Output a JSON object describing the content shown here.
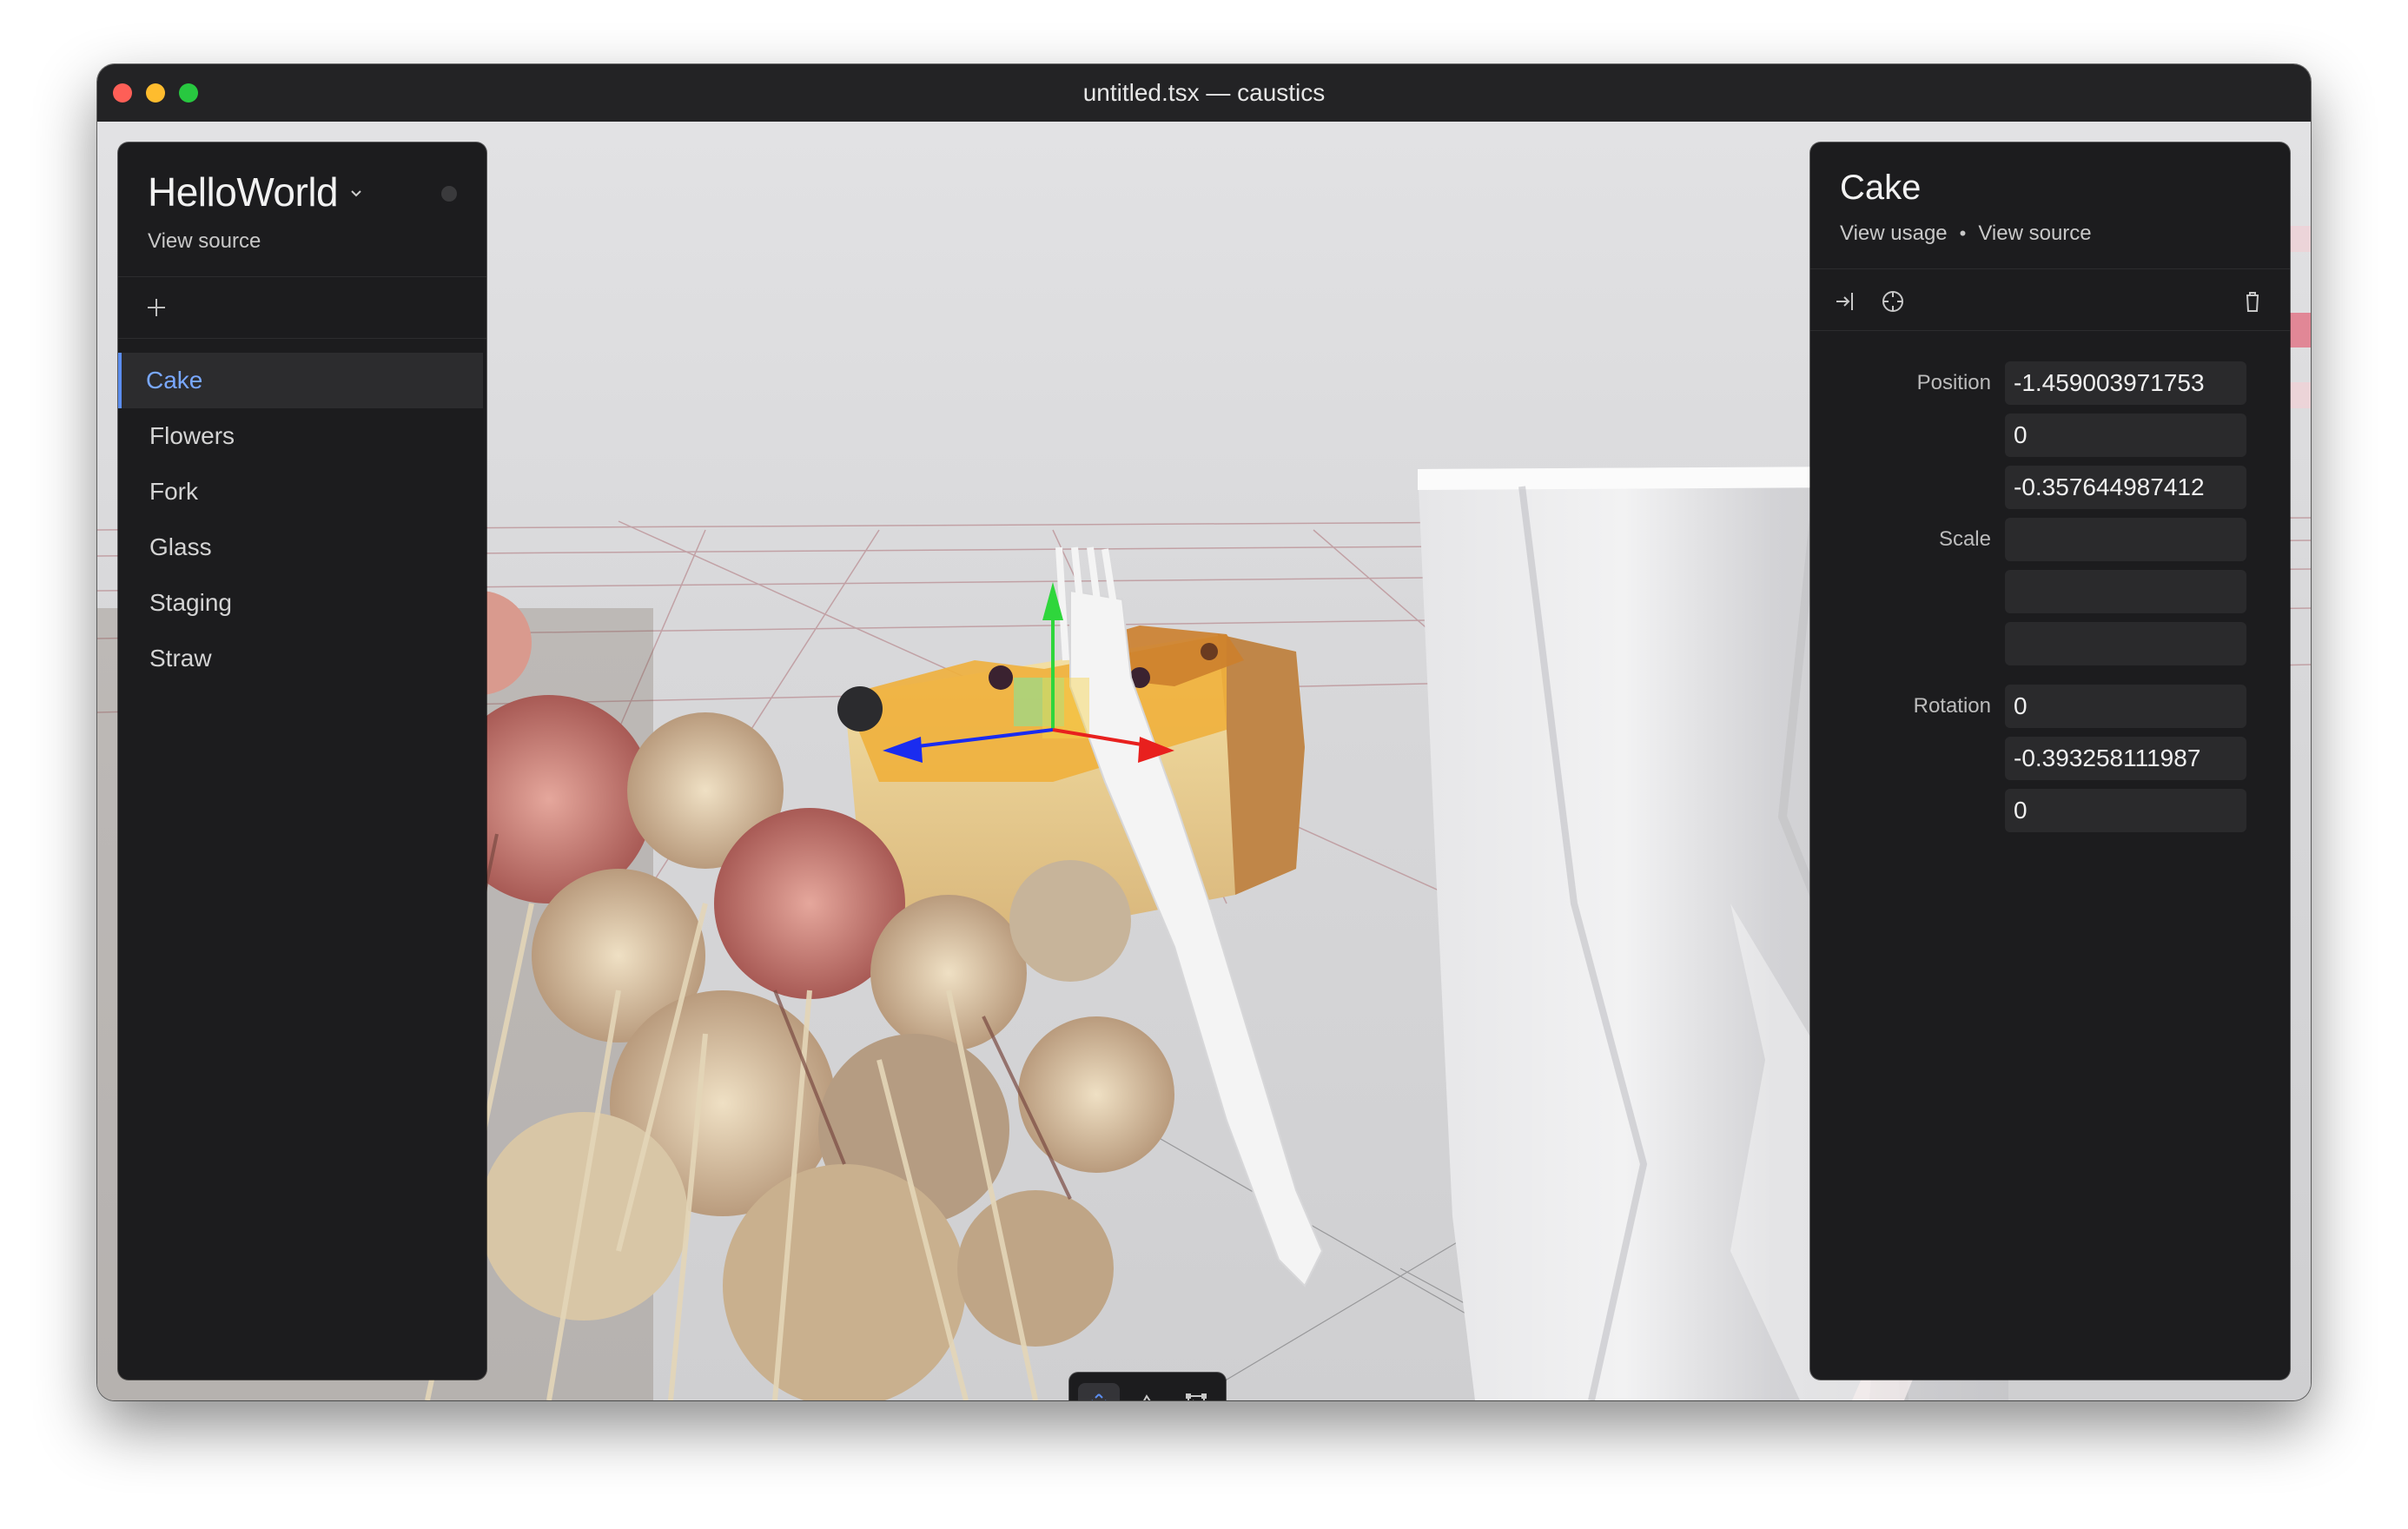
{
  "window": {
    "title": "untitled.tsx — caustics"
  },
  "project": {
    "name": "HelloWorld",
    "view_source": "View source"
  },
  "objects": {
    "active": "Cake",
    "items": [
      {
        "label": "Cake"
      },
      {
        "label": "Flowers"
      },
      {
        "label": "Fork"
      },
      {
        "label": "Glass"
      },
      {
        "label": "Staging"
      },
      {
        "label": "Straw"
      }
    ]
  },
  "inspector": {
    "title": "Cake",
    "view_usage": "View usage",
    "separator": "•",
    "view_source": "View source",
    "position_label": "Position",
    "position": [
      "-1.459003971753",
      "0",
      "-0.357644987412"
    ],
    "scale_label": "Scale",
    "scale": [
      "",
      "",
      ""
    ],
    "rotation_label": "Rotation",
    "rotation": [
      "0",
      "-0.393258111987",
      "0"
    ]
  },
  "icons": {
    "add": "plus-icon",
    "project_dropdown": "chevron-down-icon",
    "go_to": "go-to-icon",
    "focus": "crosshair-icon",
    "delete": "trash-icon",
    "translate": "move-icon",
    "rotate": "rotate-icon",
    "scale": "scale-icon"
  },
  "colors": {
    "accent": "#5b8def",
    "panel_bg": "#1c1c1e",
    "input_bg": "#2a2a2c",
    "axis_x": "#e8201e",
    "axis_y": "#2fd63c",
    "axis_z": "#1a2cf0"
  }
}
